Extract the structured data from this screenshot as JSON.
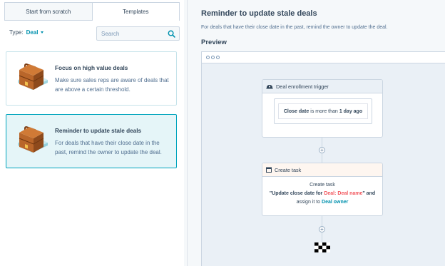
{
  "tabs": [
    {
      "label": "Start from scratch",
      "active": false
    },
    {
      "label": "Templates",
      "active": true
    }
  ],
  "filter": {
    "type_label": "Type:",
    "type_value": "Deal"
  },
  "search": {
    "placeholder": "Search"
  },
  "templates": [
    {
      "title": "Focus on high value deals",
      "description": "Make sure sales reps are aware of deals that are above a certain threshold.",
      "selected": false
    },
    {
      "title": "Reminder to update stale deals",
      "description": "For deals that have their close date in the past, remind the owner to update the deal.",
      "selected": true
    }
  ],
  "detail": {
    "title": "Reminder to update stale deals",
    "description": "For deals that have their close date in the past, remind the owner to update the deal.",
    "preview_label": "Preview"
  },
  "workflow": {
    "trigger": {
      "header": "Deal enrollment trigger",
      "condition_property": "Close date",
      "condition_operator": "is more than",
      "condition_value": "1 day ago"
    },
    "action": {
      "header": "Create task",
      "line1": "Create task",
      "line2_prefix": "\"Update close date for",
      "line2_token": "Deal: Deal name",
      "line2_suffix": "\" and",
      "line3_prefix": "assign it to",
      "line3_token": "Deal owner"
    },
    "add_symbol": "+"
  },
  "colors": {
    "accent": "#0091ae",
    "selected_bg": "#e5f5f8",
    "selected_border": "#00a4bd",
    "token_orange": "#f2545b"
  },
  "icons": {
    "template_illustration": "briefcase-icon",
    "search": "search-icon",
    "trigger": "enrollment-trigger-icon",
    "task": "task-icon",
    "end": "finish-flag-icon"
  }
}
